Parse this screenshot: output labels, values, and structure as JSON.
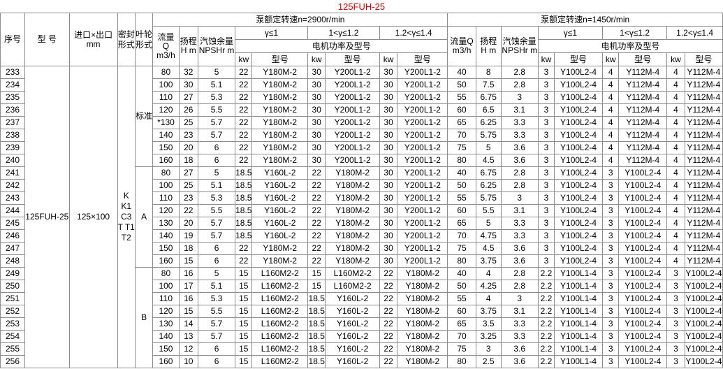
{
  "title": "125FUH-25",
  "headers": {
    "seq": "序号",
    "model": "型 号",
    "inout": "进口×出口 mm",
    "seal": "密封形式",
    "impeller": "叶轮形式",
    "speed_a": "泵额定转速n=2900r/min",
    "speed_b": "泵额定转速n=1450r/min",
    "flow_a": "流量 Q m3/h",
    "head_a": "扬程 H m",
    "npsh_a": "汽蚀余量 NPSHr m",
    "flow_b": "流量Q m3/h",
    "head_b": "扬程 H m",
    "npsh_b": "汽蚀余量 NPSHr m",
    "g1": "γ≤1",
    "g2": "1<γ≤1.2",
    "g3": "1.2<γ≤1.4",
    "motor": "电机功率及型号",
    "kw": "kw",
    "mtype": "型号"
  },
  "group": {
    "model": "125FUH-25",
    "inout": "125×100",
    "seal": "K K1 C3 T T1 T2"
  },
  "impellers": [
    {
      "label": "标准",
      "rows": 8
    },
    {
      "label": "A",
      "rows": 8
    },
    {
      "label": "B",
      "rows": 8
    }
  ],
  "rows": [
    [
      "233",
      "80",
      "32",
      "5",
      "22",
      "Y180M-2",
      "30",
      "Y200L1-2",
      "30",
      "Y200L1-2",
      "40",
      "8",
      "2.8",
      "3",
      "Y100L2-4",
      "4",
      "Y112M-4",
      "4",
      "Y112M-4"
    ],
    [
      "234",
      "100",
      "30",
      "5.1",
      "22",
      "Y180M-2",
      "30",
      "Y200L1-2",
      "30",
      "Y200L1-2",
      "50",
      "7.5",
      "2.8",
      "3",
      "Y100L2-4",
      "4",
      "Y112M-4",
      "4",
      "Y112M-4"
    ],
    [
      "235",
      "110",
      "27",
      "5.3",
      "22",
      "Y180M-2",
      "30",
      "Y200L1-2",
      "30",
      "Y200L1-2",
      "55",
      "6.75",
      "3",
      "3",
      "Y100L2-4",
      "4",
      "Y112M-4",
      "4",
      "Y112M-4"
    ],
    [
      "236",
      "120",
      "26",
      "5.5",
      "22",
      "Y180M-2",
      "30",
      "Y200L1-2",
      "30",
      "Y200L1-2",
      "60",
      "6.5",
      "3.1",
      "3",
      "Y100L2-4",
      "4",
      "Y112M-4",
      "4",
      "Y112M-4"
    ],
    [
      "237",
      "*130",
      "25",
      "5.7",
      "22",
      "Y180M-2",
      "30",
      "Y200L1-2",
      "30",
      "Y200L1-2",
      "65",
      "6.25",
      "3.3",
      "3",
      "Y100L2-4",
      "4",
      "Y112M-4",
      "4",
      "Y112M-4"
    ],
    [
      "238",
      "140",
      "23",
      "5.7",
      "22",
      "Y180M-2",
      "30",
      "Y200L1-2",
      "30",
      "Y200L1-2",
      "70",
      "5.75",
      "3.3",
      "3",
      "Y100L2-4",
      "4",
      "Y112M-4",
      "4",
      "Y112M-4"
    ],
    [
      "239",
      "150",
      "20",
      "6",
      "22",
      "Y180M-2",
      "30",
      "Y200L1-2",
      "30",
      "Y200L1-2",
      "75",
      "5",
      "3.6",
      "3",
      "Y100L2-4",
      "4",
      "Y112M-4",
      "4",
      "Y112M-4"
    ],
    [
      "240",
      "160",
      "18",
      "6",
      "22",
      "Y180M-2",
      "30",
      "Y200L1-2",
      "30",
      "Y200L1-2",
      "80",
      "4.5",
      "3.6",
      "3",
      "Y100L2-4",
      "4",
      "Y112M-4",
      "4",
      "Y112M-4"
    ],
    [
      "241",
      "80",
      "27",
      "5",
      "18.5",
      "Y160L-2",
      "22",
      "Y180M-2",
      "30",
      "Y200L1-2",
      "40",
      "6.75",
      "2.8",
      "3",
      "Y100L2-4",
      "3",
      "Y100L2-4",
      "4",
      "Y112M-4"
    ],
    [
      "242",
      "100",
      "25",
      "5.1",
      "18.5",
      "Y160L-2",
      "22",
      "Y180M-2",
      "30",
      "Y200L1-2",
      "50",
      "6.25",
      "2.8",
      "3",
      "Y100L2-4",
      "3",
      "Y100L2-4",
      "4",
      "Y112M-4"
    ],
    [
      "243",
      "110",
      "23",
      "5.3",
      "18.5",
      "Y160L-2",
      "22",
      "Y180M-2",
      "30",
      "Y200L1-2",
      "55",
      "5.75",
      "3",
      "3",
      "Y100L2-4",
      "3",
      "Y100L2-4",
      "4",
      "Y112M-4"
    ],
    [
      "244",
      "120",
      "22",
      "5.5",
      "18.5",
      "Y160L-2",
      "22",
      "Y180M-2",
      "30",
      "Y200L1-2",
      "60",
      "5.5",
      "3.1",
      "3",
      "Y100L2-4",
      "3",
      "Y100L2-4",
      "4",
      "Y112M-4"
    ],
    [
      "245",
      "130",
      "20",
      "5.7",
      "18.5",
      "Y160L-2",
      "22",
      "Y180M-2",
      "30",
      "Y200L1-2",
      "65",
      "5",
      "3.3",
      "3",
      "Y100L2-4",
      "3",
      "Y100L2-4",
      "4",
      "Y112M-4"
    ],
    [
      "246",
      "140",
      "19",
      "5.7",
      "18.5",
      "Y160L-2",
      "22",
      "Y180M-2",
      "30",
      "Y200L1-2",
      "70",
      "4.75",
      "3.3",
      "3",
      "Y100L2-4",
      "3",
      "Y100L2-4",
      "4",
      "Y112M-4"
    ],
    [
      "247",
      "150",
      "18",
      "6",
      "22",
      "Y180M-2",
      "22",
      "Y180M-2",
      "30",
      "Y200L1-2",
      "75",
      "4.5",
      "3.6",
      "3",
      "Y100L2-4",
      "3",
      "Y100L2-4",
      "4",
      "Y112M-4"
    ],
    [
      "248",
      "160",
      "15",
      "6",
      "22",
      "Y180M-2",
      "22",
      "Y180M-2",
      "30",
      "Y200L1-2",
      "80",
      "3.75",
      "3.6",
      "3",
      "Y100L2-4",
      "3",
      "Y100L2-4",
      "4",
      "Y112M-4"
    ],
    [
      "249",
      "80",
      "16",
      "5",
      "15",
      "L160M2-2",
      "15",
      "L160M2-2",
      "22",
      "Y180M-2",
      "40",
      "4",
      "2.8",
      "2.2",
      "Y100L1-4",
      "3",
      "Y100L2-4",
      "3",
      "Y100L2-4"
    ],
    [
      "250",
      "100",
      "17",
      "5.1",
      "15",
      "L160M2-2",
      "15",
      "L160M2-2",
      "22",
      "Y180M-2",
      "50",
      "4.25",
      "2.8",
      "2.2",
      "Y100L1-4",
      "3",
      "Y100L2-4",
      "3",
      "Y100L2-4"
    ],
    [
      "251",
      "110",
      "16",
      "5.3",
      "15",
      "L160M2-2",
      "18.5",
      "Y160L-2",
      "22",
      "Y180M-2",
      "55",
      "4",
      "3",
      "2.2",
      "Y100L1-4",
      "3",
      "Y100L2-4",
      "3",
      "Y100L2-4"
    ],
    [
      "252",
      "120",
      "15",
      "5.5",
      "15",
      "L160M2-2",
      "18.5",
      "Y160L-2",
      "22",
      "Y180M-2",
      "60",
      "3.75",
      "3.1",
      "2.2",
      "Y100L1-4",
      "3",
      "Y100L2-4",
      "3",
      "Y100L2-4"
    ],
    [
      "253",
      "130",
      "14",
      "5.7",
      "15",
      "L160M2-2",
      "18.5",
      "Y160L-2",
      "22",
      "Y180M-2",
      "65",
      "3.5",
      "3.3",
      "2.2",
      "Y100L1-4",
      "3",
      "Y100L2-4",
      "3",
      "Y100L2-4"
    ],
    [
      "254",
      "140",
      "13",
      "5.7",
      "15",
      "L160M2-2",
      "18.5",
      "Y160L-2",
      "22",
      "Y180M-2",
      "70",
      "3.25",
      "3.3",
      "2.2",
      "Y100L1-4",
      "3",
      "Y100L2-4",
      "3",
      "Y100L2-4"
    ],
    [
      "255",
      "150",
      "12",
      "6",
      "15",
      "L160M2-2",
      "18.5",
      "Y160L-2",
      "22",
      "Y180M-2",
      "75",
      "3",
      "3.6",
      "2.2",
      "Y100L1-4",
      "3",
      "Y100L2-4",
      "3",
      "Y100L2-4"
    ],
    [
      "256",
      "160",
      "10",
      "6",
      "15",
      "L160M2-2",
      "18.5",
      "Y160L-2",
      "22",
      "Y180M-2",
      "80",
      "2.5",
      "3.6",
      "2.2",
      "Y100L1-4",
      "3",
      "Y100L2-4",
      "3",
      "Y100L2-4"
    ]
  ],
  "colors": {
    "title": "#e00000",
    "border": "#8c8c8c"
  }
}
